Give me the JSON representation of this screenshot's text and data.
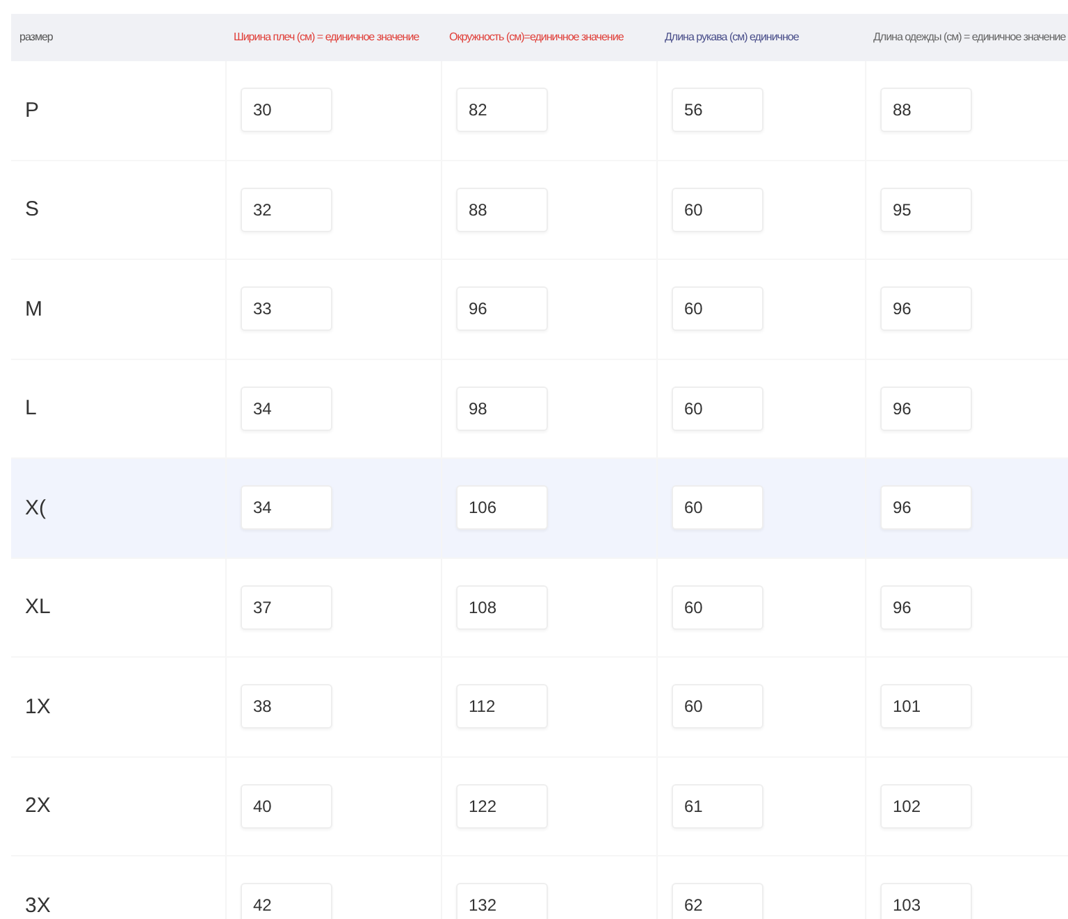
{
  "table": {
    "columns": [
      {
        "label": "размер",
        "color": "#555555"
      },
      {
        "label": "Ширина плеч (см) = единичное значение",
        "color": "#e0403a"
      },
      {
        "label": "Окружность (см)=единичное значение",
        "color": "#e0403a"
      },
      {
        "label": "Длина рукава (см) единичное",
        "color": "#4a4f8a"
      },
      {
        "label": "Длина одежды (см) = единичное значение",
        "color": "#666666"
      }
    ],
    "rows": [
      {
        "size": "P",
        "selected": false,
        "values": [
          "30",
          "82",
          "56",
          "88"
        ]
      },
      {
        "size": "S",
        "selected": false,
        "values": [
          "32",
          "88",
          "60",
          "95"
        ]
      },
      {
        "size": "M",
        "selected": false,
        "values": [
          "33",
          "96",
          "60",
          "96"
        ]
      },
      {
        "size": "L",
        "selected": false,
        "values": [
          "34",
          "98",
          "60",
          "96"
        ]
      },
      {
        "size": "X(",
        "selected": true,
        "values": [
          "34",
          "106",
          "60",
          "96"
        ]
      },
      {
        "size": "XL",
        "selected": false,
        "values": [
          "37",
          "108",
          "60",
          "96"
        ]
      },
      {
        "size": "1X",
        "selected": false,
        "values": [
          "38",
          "112",
          "60",
          "101"
        ]
      },
      {
        "size": "2X",
        "selected": false,
        "values": [
          "40",
          "122",
          "61",
          "102"
        ]
      },
      {
        "size": "3X",
        "selected": false,
        "values": [
          "42",
          "132",
          "62",
          "103"
        ]
      }
    ]
  }
}
